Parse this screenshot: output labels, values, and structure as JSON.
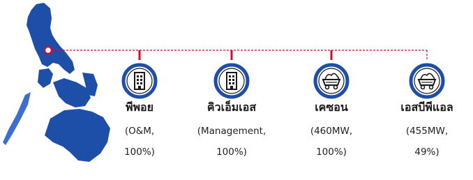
{
  "colors": {
    "map_fill": "#1E4FA8",
    "map_light": "#3C6FD0",
    "connector": "#C8102E",
    "icon_ring": "#1E4FA8",
    "icon_outline": "#1a1a1a"
  },
  "entities": [
    {
      "name": "พีพอย",
      "icon": "building-icon",
      "detail_line1": "(O&M,",
      "detail_line2": "100%)"
    },
    {
      "name": "คิวเอ็มเอส",
      "icon": "building-icon",
      "detail_line1": "(Management,",
      "detail_line2": "100%)"
    },
    {
      "name": "เคซอน",
      "icon": "coal-cart-icon",
      "detail_line1": "(460MW,",
      "detail_line2": "100%)"
    },
    {
      "name": "เอสบีพีแอล",
      "icon": "coal-cart-icon",
      "detail_line1": "(455MW,",
      "detail_line2": "49%)"
    }
  ]
}
